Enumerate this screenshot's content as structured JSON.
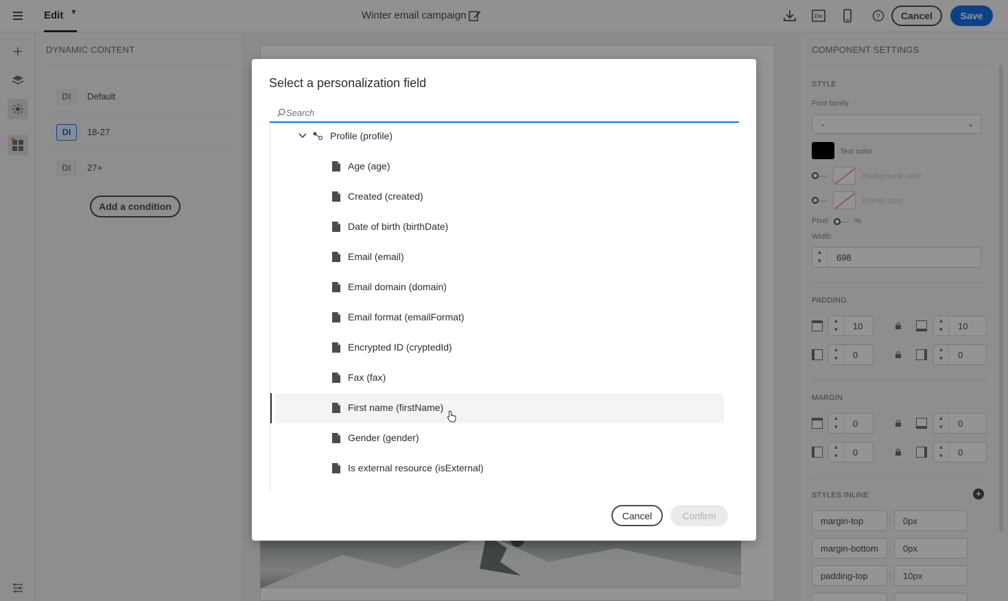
{
  "topbar": {
    "edit_label": "Edit",
    "document_title": "Winter email campaign",
    "cancel_label": "Cancel",
    "save_label": "Save",
    "icons": [
      "menu-icon",
      "chevron-down-icon",
      "edit-pencil-icon",
      "download-icon",
      "dreamweaver-icon",
      "mobile-preview-icon",
      "help-icon"
    ],
    "accent_color": "#1473e6"
  },
  "rail": {
    "icons": [
      "add-icon",
      "layers-icon",
      "personalization-icon",
      "dynamic-content-icon",
      "settings-icon"
    ]
  },
  "left_panel": {
    "title": "DYNAMIC CONTENT",
    "items": [
      {
        "badge": "DI",
        "label": "Default",
        "selected": false
      },
      {
        "badge": "DI",
        "label": "18-27",
        "selected": true
      },
      {
        "badge": "DI",
        "label": "27+",
        "selected": false
      }
    ],
    "add_condition_label": "Add a condition"
  },
  "right_panel": {
    "title": "COMPONENT SETTINGS",
    "style": {
      "section": "STYLE",
      "font_family_label": "Font family",
      "font_family_value": "-",
      "text_color_label": "Text color",
      "text_color": "#000000",
      "background_color_label": "Background color",
      "border_color_label": "Border color",
      "pixel_label": "Pixel",
      "percent_label": "%",
      "width_label": "Width",
      "width_value": "698"
    },
    "padding": {
      "section": "PADDING",
      "top": "10",
      "bottom": "10",
      "left": "0",
      "right": "0"
    },
    "margin": {
      "section": "MARGIN",
      "top": "0",
      "bottom": "0",
      "left": "0",
      "right": "0"
    },
    "styles_inline": {
      "section": "STYLES INLINE",
      "rows": [
        {
          "key": "margin-top",
          "value": "0px"
        },
        {
          "key": "margin-bottom",
          "value": "0px"
        },
        {
          "key": "padding-top",
          "value": "10px"
        }
      ]
    }
  },
  "modal": {
    "title": "Select a personalization field",
    "search_placeholder": "Search",
    "tree": {
      "parent": "Profile (profile)",
      "fields": [
        "Age (age)",
        "Created (created)",
        "Date of birth (birthDate)",
        "Email (email)",
        "Email domain (domain)",
        "Email format (emailFormat)",
        "Encrypted ID (cryptedId)",
        "Fax (fax)",
        "First name (firstName)",
        "Gender (gender)",
        "Is external resource (isExternal)"
      ],
      "hovered_field": "First name (firstName)"
    },
    "cancel_label": "Cancel",
    "confirm_label": "Confirm"
  }
}
